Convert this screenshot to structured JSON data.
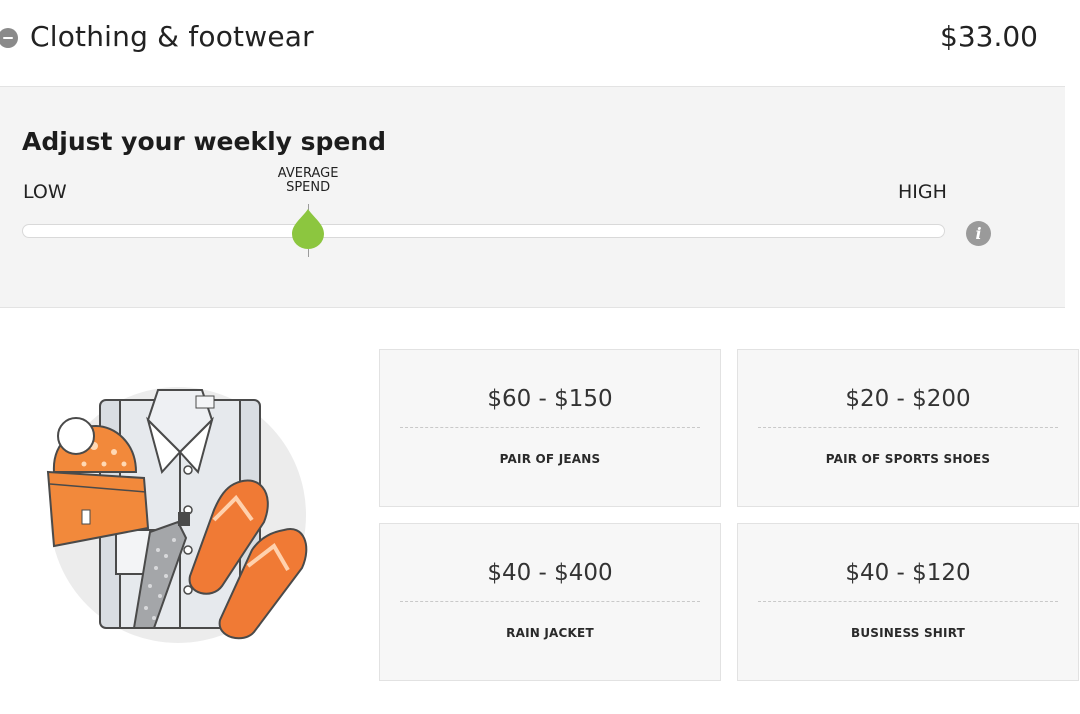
{
  "header": {
    "title": "Clothing & footwear",
    "total": "$33.00"
  },
  "adjust": {
    "title": "Adjust your weekly spend",
    "low_label": "LOW",
    "high_label": "HIGH",
    "average_label_line1": "AVERAGE",
    "average_label_line2": "SPEND",
    "slider_value_fraction": 0.31,
    "accent_color": "#8cc63f"
  },
  "illustration": {
    "icon": "clothing-illustration"
  },
  "cards": [
    {
      "price": "$60 - $150",
      "label": "PAIR OF JEANS"
    },
    {
      "price": "$20 - $200",
      "label": "PAIR OF SPORTS SHOES"
    },
    {
      "price": "$40 - $400",
      "label": "RAIN JACKET"
    },
    {
      "price": "$40 - $120",
      "label": "BUSINESS SHIRT"
    }
  ]
}
